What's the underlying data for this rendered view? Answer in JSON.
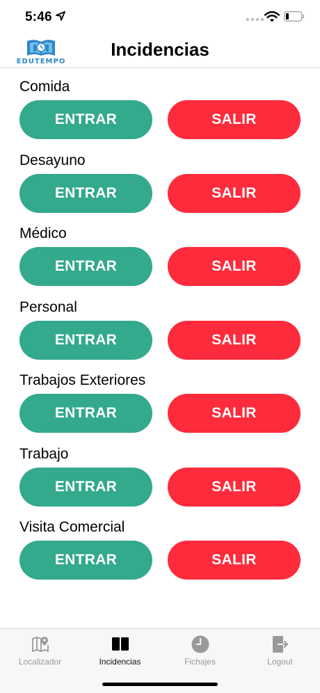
{
  "status_bar": {
    "time": "5:46"
  },
  "header": {
    "title": "Incidencias",
    "logo_text": "EDUTEMPO"
  },
  "incidents": [
    {
      "label": "Comida",
      "enter_label": "ENTRAR",
      "exit_label": "SALIR"
    },
    {
      "label": "Desayuno",
      "enter_label": "ENTRAR",
      "exit_label": "SALIR"
    },
    {
      "label": "Médico",
      "enter_label": "ENTRAR",
      "exit_label": "SALIR"
    },
    {
      "label": "Personal",
      "enter_label": "ENTRAR",
      "exit_label": "SALIR"
    },
    {
      "label": "Trabajos Exteriores",
      "enter_label": "ENTRAR",
      "exit_label": "SALIR"
    },
    {
      "label": "Trabajo",
      "enter_label": "ENTRAR",
      "exit_label": "SALIR"
    },
    {
      "label": "Visita Comercial",
      "enter_label": "ENTRAR",
      "exit_label": "SALIR"
    }
  ],
  "tabs": [
    {
      "label": "Localizador",
      "icon": "map-pin-icon",
      "active": false
    },
    {
      "label": "Incidencias",
      "icon": "book-icon",
      "active": true
    },
    {
      "label": "Fichajes",
      "icon": "clock-icon",
      "active": false
    },
    {
      "label": "Logout",
      "icon": "logout-icon",
      "active": false
    }
  ],
  "colors": {
    "enter_button": "#33a98d",
    "exit_button": "#fd2b3b",
    "inactive_tab": "#999999",
    "active_tab": "#111111"
  }
}
